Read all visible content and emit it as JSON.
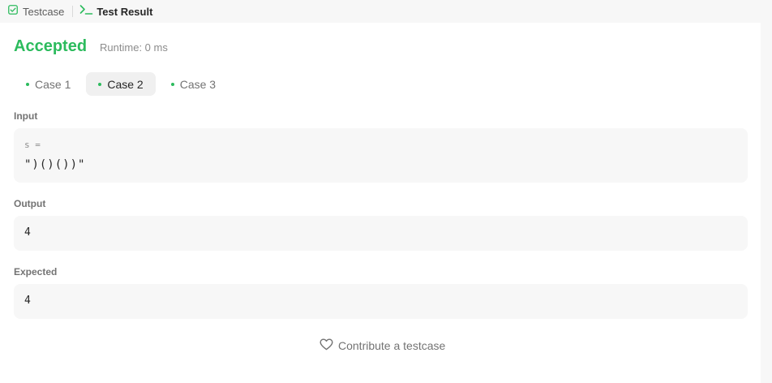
{
  "tabs": {
    "testcase": {
      "label": "Testcase",
      "icon": "checkbox-icon"
    },
    "result": {
      "label": "Test Result",
      "icon": "terminal-prompt-icon"
    }
  },
  "status": {
    "verdict": "Accepted",
    "runtime": "Runtime: 0 ms"
  },
  "cases": [
    {
      "label": "Case 1",
      "active": false
    },
    {
      "label": "Case 2",
      "active": true
    },
    {
      "label": "Case 3",
      "active": false
    }
  ],
  "input": {
    "label": "Input",
    "variable": "s =",
    "value": "\")()())\""
  },
  "output": {
    "label": "Output",
    "value": "4"
  },
  "expected": {
    "label": "Expected",
    "value": "4"
  },
  "contribute": {
    "label": "Contribute a testcase",
    "icon": "heart-icon"
  },
  "colors": {
    "accepted": "#2cbb5d",
    "case_dot": "#2cbb5d",
    "box_bg": "#f7f7f7"
  }
}
